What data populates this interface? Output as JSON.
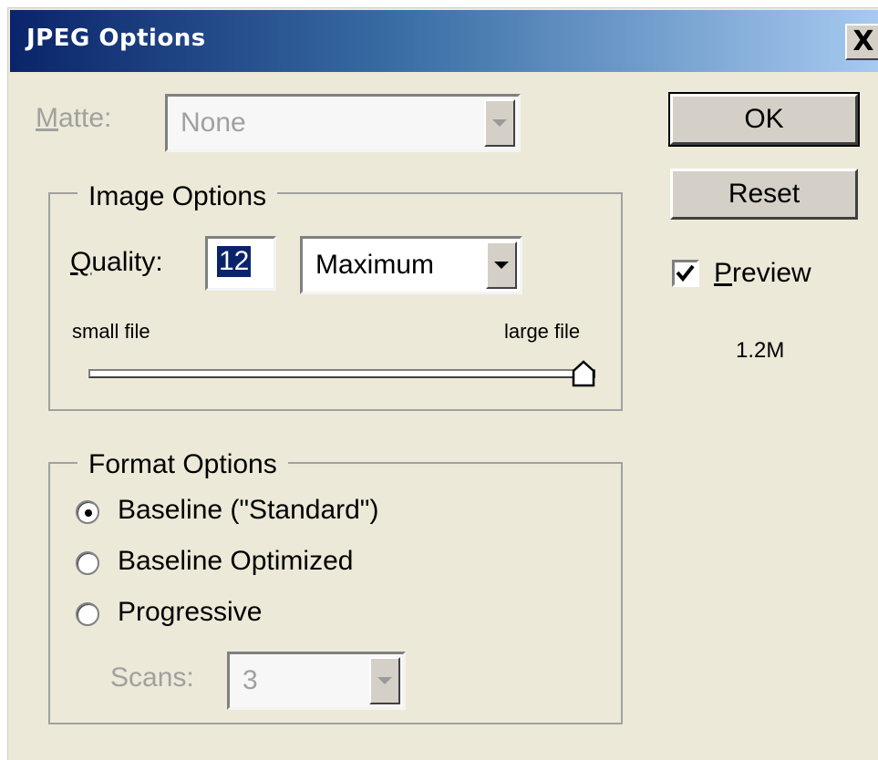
{
  "window": {
    "title": "JPEG Options",
    "close_label": "X"
  },
  "matte": {
    "label": "Matte:",
    "mnemonic": "M",
    "label_rest": "atte:",
    "value": "None",
    "enabled": false
  },
  "image_options": {
    "title": "Image Options",
    "quality_label_mnemonic": "Q",
    "quality_label_rest": "uality:",
    "quality_value": "12",
    "quality_preset": "Maximum",
    "slider_min_label": "small file",
    "slider_max_label": "large file",
    "slider_fraction": 1.0
  },
  "buttons": {
    "ok_label": "OK",
    "reset_label": "Reset"
  },
  "preview": {
    "mnemonic": "P",
    "label_rest": "review",
    "checked": true,
    "file_size": "1.2M"
  },
  "format_options": {
    "title": "Format Options",
    "options": [
      {
        "label": "Baseline (\"Standard\")",
        "selected": true
      },
      {
        "label": "Baseline Optimized",
        "selected": false
      },
      {
        "label": "Progressive",
        "selected": false
      }
    ],
    "scans_label": "Scans:",
    "scans_value": "3",
    "scans_enabled": false
  }
}
